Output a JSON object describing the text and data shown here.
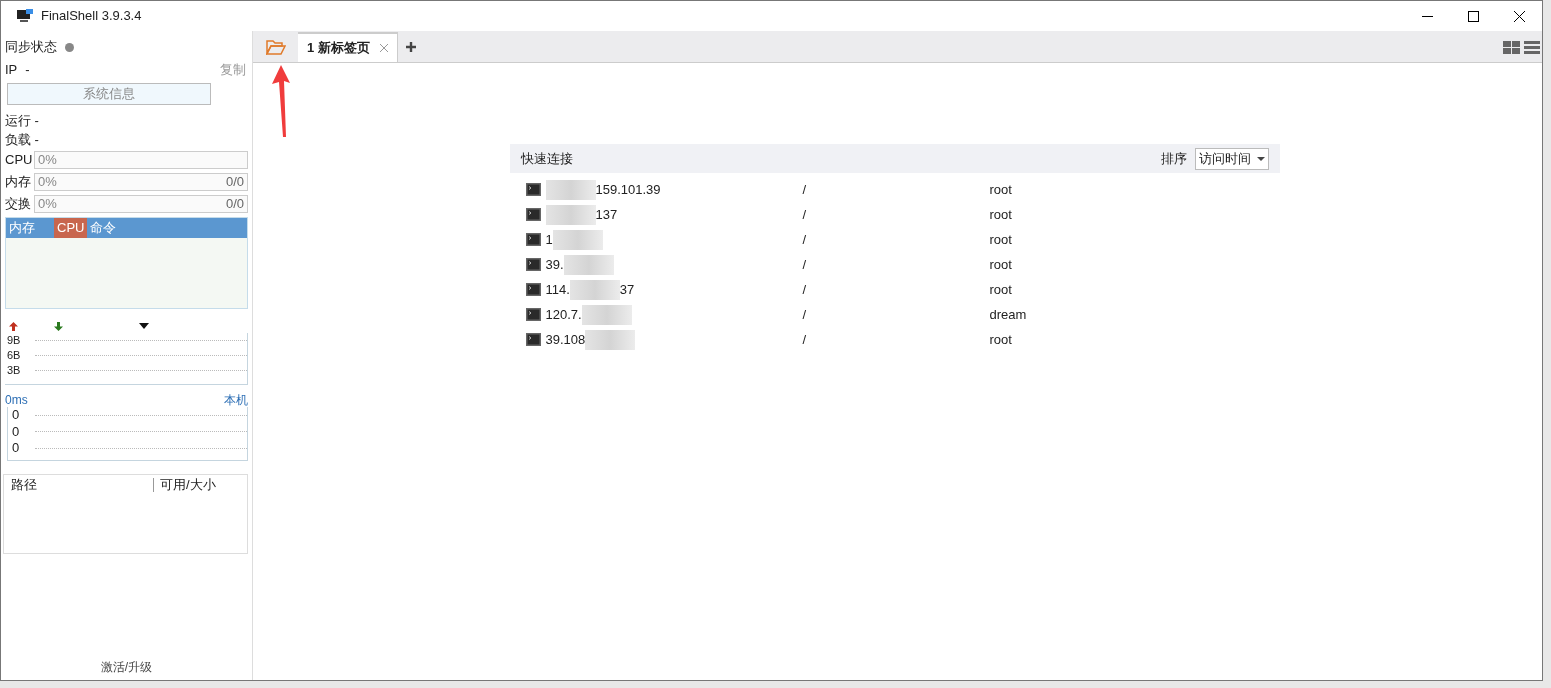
{
  "window": {
    "title": "FinalShell 3.9.3.4"
  },
  "sidebar": {
    "sync_label": "同步状态",
    "ip_label": "IP",
    "ip_value": "-",
    "copy_link": "复制",
    "sysinfo_button": "系统信息",
    "stats": [
      "运行 -",
      "负载 -"
    ],
    "meters": [
      {
        "label": "CPU",
        "reading": "0%",
        "level": 0
      },
      {
        "label": "内存",
        "reading": "0%",
        "total": "0/0",
        "level": 0
      },
      {
        "label": "交换",
        "reading": "0%",
        "total": "0/0",
        "level": 0
      }
    ],
    "process_tabs": [
      {
        "label": "内存",
        "selected": false
      },
      {
        "label": "CPU",
        "selected": true
      },
      {
        "label": "命令",
        "selected": false
      }
    ],
    "net_ticks": [
      "9B",
      "6B",
      "3B"
    ],
    "ping": {
      "latency": "0ms",
      "target": "本机",
      "ticks": [
        "0",
        "0",
        "0"
      ]
    },
    "disk_columns": [
      "路径",
      "可用/大小"
    ],
    "activate_link": "激活/升级"
  },
  "tabs": [
    {
      "label": "1 新标签页",
      "selected": true
    }
  ],
  "quick_connect": {
    "title": "快速连接",
    "sort_label": "排序",
    "sort_value": "访问时间",
    "rows": [
      {
        "host_parts": [
          {
            "kind": "mask"
          },
          {
            "kind": "text",
            "text": "159.101.39"
          }
        ],
        "path": "/",
        "user": "root"
      },
      {
        "host_parts": [
          {
            "kind": "mask"
          },
          {
            "kind": "text",
            "text": "137"
          }
        ],
        "path": "/",
        "user": "root"
      },
      {
        "host_parts": [
          {
            "kind": "text",
            "text": "1"
          },
          {
            "kind": "mask"
          }
        ],
        "path": "/",
        "user": "root"
      },
      {
        "host_parts": [
          {
            "kind": "text",
            "text": "39."
          },
          {
            "kind": "mask"
          }
        ],
        "path": "/",
        "user": "root"
      },
      {
        "host_parts": [
          {
            "kind": "text",
            "text": "114."
          },
          {
            "kind": "mask"
          },
          {
            "kind": "text",
            "text": "37"
          }
        ],
        "path": "/",
        "user": "root"
      },
      {
        "host_parts": [
          {
            "kind": "text",
            "text": "120.7."
          },
          {
            "kind": "mask"
          }
        ],
        "path": "/",
        "user": "dream"
      },
      {
        "host_parts": [
          {
            "kind": "text",
            "text": "39.108"
          },
          {
            "kind": "mask"
          }
        ],
        "path": "/",
        "user": "root"
      }
    ]
  }
}
